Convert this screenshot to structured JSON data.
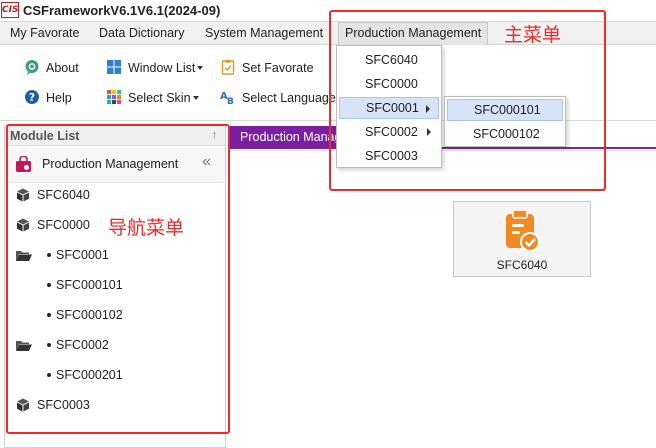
{
  "window": {
    "logo_text": "CIS",
    "title": "CSFrameworkV6.1V6.1(2024-09)"
  },
  "menubar": [
    {
      "label": "My Favorate"
    },
    {
      "label": "Data Dictionary"
    },
    {
      "label": "System Management"
    },
    {
      "label": "Production Management"
    }
  ],
  "toolbar": {
    "about": "About",
    "help": "Help",
    "window_list": "Window List",
    "select_skin": "Select Skin",
    "set_favorate": "Set Favorate",
    "select_language": "Select Language"
  },
  "module_panel": {
    "title": "Module List",
    "pin_glyph": "↑",
    "group_title": "Production Management",
    "collapse_glyph": "«",
    "items": [
      {
        "label": "SFC6040"
      },
      {
        "label": "SFC0000"
      },
      {
        "label": "SFC0001"
      },
      {
        "label": "SFC000101"
      },
      {
        "label": "SFC000102"
      },
      {
        "label": "SFC0002"
      },
      {
        "label": "SFC000201"
      },
      {
        "label": "SFC0003"
      }
    ]
  },
  "workspace": {
    "active_tab": "Production Management",
    "tile_label": "SFC6040"
  },
  "dropdown_main": {
    "items": [
      {
        "label": "SFC6040"
      },
      {
        "label": "SFC0000"
      },
      {
        "label": "SFC0001"
      },
      {
        "label": "SFC0002"
      },
      {
        "label": "SFC0003"
      }
    ]
  },
  "dropdown_sub": {
    "items": [
      {
        "label": "SFC000101"
      },
      {
        "label": "SFC000102"
      }
    ]
  },
  "annotations": {
    "main_menu": "主菜单",
    "nav_menu": "导航菜单"
  },
  "colors": {
    "accent_purple": "#7b1fa2",
    "annotation_red": "#ee2a2a",
    "highlight_blue": "#d7e3f7",
    "icon_orange": "#f08a24"
  }
}
